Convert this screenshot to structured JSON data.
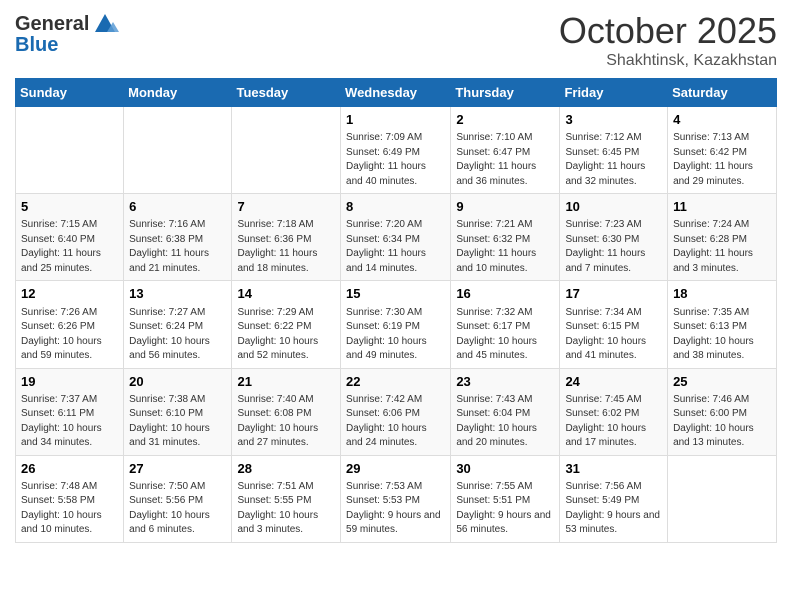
{
  "header": {
    "logo_general": "General",
    "logo_blue": "Blue",
    "month": "October 2025",
    "location": "Shakhtinsk, Kazakhstan"
  },
  "days_of_week": [
    "Sunday",
    "Monday",
    "Tuesday",
    "Wednesday",
    "Thursday",
    "Friday",
    "Saturday"
  ],
  "weeks": [
    {
      "days": [
        {
          "number": "",
          "info": ""
        },
        {
          "number": "",
          "info": ""
        },
        {
          "number": "",
          "info": ""
        },
        {
          "number": "1",
          "info": "Sunrise: 7:09 AM\nSunset: 6:49 PM\nDaylight: 11 hours\nand 40 minutes."
        },
        {
          "number": "2",
          "info": "Sunrise: 7:10 AM\nSunset: 6:47 PM\nDaylight: 11 hours\nand 36 minutes."
        },
        {
          "number": "3",
          "info": "Sunrise: 7:12 AM\nSunset: 6:45 PM\nDaylight: 11 hours\nand 32 minutes."
        },
        {
          "number": "4",
          "info": "Sunrise: 7:13 AM\nSunset: 6:42 PM\nDaylight: 11 hours\nand 29 minutes."
        }
      ]
    },
    {
      "days": [
        {
          "number": "5",
          "info": "Sunrise: 7:15 AM\nSunset: 6:40 PM\nDaylight: 11 hours\nand 25 minutes."
        },
        {
          "number": "6",
          "info": "Sunrise: 7:16 AM\nSunset: 6:38 PM\nDaylight: 11 hours\nand 21 minutes."
        },
        {
          "number": "7",
          "info": "Sunrise: 7:18 AM\nSunset: 6:36 PM\nDaylight: 11 hours\nand 18 minutes."
        },
        {
          "number": "8",
          "info": "Sunrise: 7:20 AM\nSunset: 6:34 PM\nDaylight: 11 hours\nand 14 minutes."
        },
        {
          "number": "9",
          "info": "Sunrise: 7:21 AM\nSunset: 6:32 PM\nDaylight: 11 hours\nand 10 minutes."
        },
        {
          "number": "10",
          "info": "Sunrise: 7:23 AM\nSunset: 6:30 PM\nDaylight: 11 hours\nand 7 minutes."
        },
        {
          "number": "11",
          "info": "Sunrise: 7:24 AM\nSunset: 6:28 PM\nDaylight: 11 hours\nand 3 minutes."
        }
      ]
    },
    {
      "days": [
        {
          "number": "12",
          "info": "Sunrise: 7:26 AM\nSunset: 6:26 PM\nDaylight: 10 hours\nand 59 minutes."
        },
        {
          "number": "13",
          "info": "Sunrise: 7:27 AM\nSunset: 6:24 PM\nDaylight: 10 hours\nand 56 minutes."
        },
        {
          "number": "14",
          "info": "Sunrise: 7:29 AM\nSunset: 6:22 PM\nDaylight: 10 hours\nand 52 minutes."
        },
        {
          "number": "15",
          "info": "Sunrise: 7:30 AM\nSunset: 6:19 PM\nDaylight: 10 hours\nand 49 minutes."
        },
        {
          "number": "16",
          "info": "Sunrise: 7:32 AM\nSunset: 6:17 PM\nDaylight: 10 hours\nand 45 minutes."
        },
        {
          "number": "17",
          "info": "Sunrise: 7:34 AM\nSunset: 6:15 PM\nDaylight: 10 hours\nand 41 minutes."
        },
        {
          "number": "18",
          "info": "Sunrise: 7:35 AM\nSunset: 6:13 PM\nDaylight: 10 hours\nand 38 minutes."
        }
      ]
    },
    {
      "days": [
        {
          "number": "19",
          "info": "Sunrise: 7:37 AM\nSunset: 6:11 PM\nDaylight: 10 hours\nand 34 minutes."
        },
        {
          "number": "20",
          "info": "Sunrise: 7:38 AM\nSunset: 6:10 PM\nDaylight: 10 hours\nand 31 minutes."
        },
        {
          "number": "21",
          "info": "Sunrise: 7:40 AM\nSunset: 6:08 PM\nDaylight: 10 hours\nand 27 minutes."
        },
        {
          "number": "22",
          "info": "Sunrise: 7:42 AM\nSunset: 6:06 PM\nDaylight: 10 hours\nand 24 minutes."
        },
        {
          "number": "23",
          "info": "Sunrise: 7:43 AM\nSunset: 6:04 PM\nDaylight: 10 hours\nand 20 minutes."
        },
        {
          "number": "24",
          "info": "Sunrise: 7:45 AM\nSunset: 6:02 PM\nDaylight: 10 hours\nand 17 minutes."
        },
        {
          "number": "25",
          "info": "Sunrise: 7:46 AM\nSunset: 6:00 PM\nDaylight: 10 hours\nand 13 minutes."
        }
      ]
    },
    {
      "days": [
        {
          "number": "26",
          "info": "Sunrise: 7:48 AM\nSunset: 5:58 PM\nDaylight: 10 hours\nand 10 minutes."
        },
        {
          "number": "27",
          "info": "Sunrise: 7:50 AM\nSunset: 5:56 PM\nDaylight: 10 hours\nand 6 minutes."
        },
        {
          "number": "28",
          "info": "Sunrise: 7:51 AM\nSunset: 5:55 PM\nDaylight: 10 hours\nand 3 minutes."
        },
        {
          "number": "29",
          "info": "Sunrise: 7:53 AM\nSunset: 5:53 PM\nDaylight: 9 hours\nand 59 minutes."
        },
        {
          "number": "30",
          "info": "Sunrise: 7:55 AM\nSunset: 5:51 PM\nDaylight: 9 hours\nand 56 minutes."
        },
        {
          "number": "31",
          "info": "Sunrise: 7:56 AM\nSunset: 5:49 PM\nDaylight: 9 hours\nand 53 minutes."
        },
        {
          "number": "",
          "info": ""
        }
      ]
    }
  ]
}
